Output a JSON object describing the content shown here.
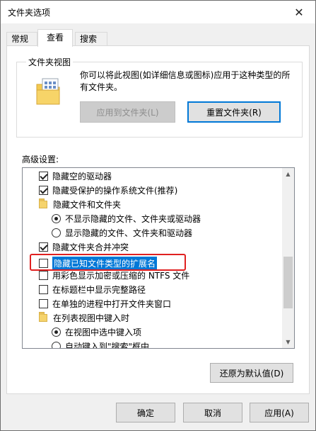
{
  "window": {
    "title": "文件夹选项",
    "close_glyph": "✕"
  },
  "tabs": [
    {
      "label": "常规",
      "active": false
    },
    {
      "label": "查看",
      "active": true
    },
    {
      "label": "搜索",
      "active": false
    }
  ],
  "folder_view": {
    "legend": "文件夹视图",
    "description": "你可以将此视图(如详细信息或图标)应用于这种类型的所有文件夹。",
    "apply_button": "应用到文件夹(L)",
    "reset_button": "重置文件夹(R)"
  },
  "advanced": {
    "label": "高级设置:",
    "items": [
      {
        "type": "checkbox",
        "checked": true,
        "indent": 0,
        "label": "隐藏空的驱动器"
      },
      {
        "type": "checkbox",
        "checked": true,
        "indent": 0,
        "label": "隐藏受保护的操作系统文件(推荐)"
      },
      {
        "type": "folder",
        "indent": 0,
        "label": "隐藏文件和文件夹"
      },
      {
        "type": "radio",
        "checked": true,
        "indent": 1,
        "label": "不显示隐藏的文件、文件夹或驱动器"
      },
      {
        "type": "radio",
        "checked": false,
        "indent": 1,
        "label": "显示隐藏的文件、文件夹和驱动器"
      },
      {
        "type": "checkbox",
        "checked": true,
        "indent": 0,
        "label": "隐藏文件夹合并冲突"
      },
      {
        "type": "checkbox",
        "checked": false,
        "indent": 0,
        "label": "隐藏已知文件类型的扩展名",
        "selected": true
      },
      {
        "type": "checkbox",
        "checked": false,
        "indent": 0,
        "label": "用彩色显示加密或压缩的 NTFS 文件"
      },
      {
        "type": "checkbox",
        "checked": false,
        "indent": 0,
        "label": "在标题栏中显示完整路径"
      },
      {
        "type": "checkbox",
        "checked": false,
        "indent": 0,
        "label": "在单独的进程中打开文件夹窗口"
      },
      {
        "type": "folder",
        "indent": 0,
        "label": "在列表视图中键入时"
      },
      {
        "type": "radio",
        "checked": true,
        "indent": 1,
        "label": "在视图中选中键入项"
      },
      {
        "type": "radio",
        "checked": false,
        "indent": 1,
        "label": "自动键入到\"搜索\"框中"
      }
    ],
    "restore_button": "还原为默认值(D)"
  },
  "footer": {
    "ok": "确定",
    "cancel": "取消",
    "apply": "应用(A)"
  },
  "colors": {
    "selection": "#0078d7",
    "highlight_border": "#e02020",
    "focus_border": "#0078d7"
  }
}
